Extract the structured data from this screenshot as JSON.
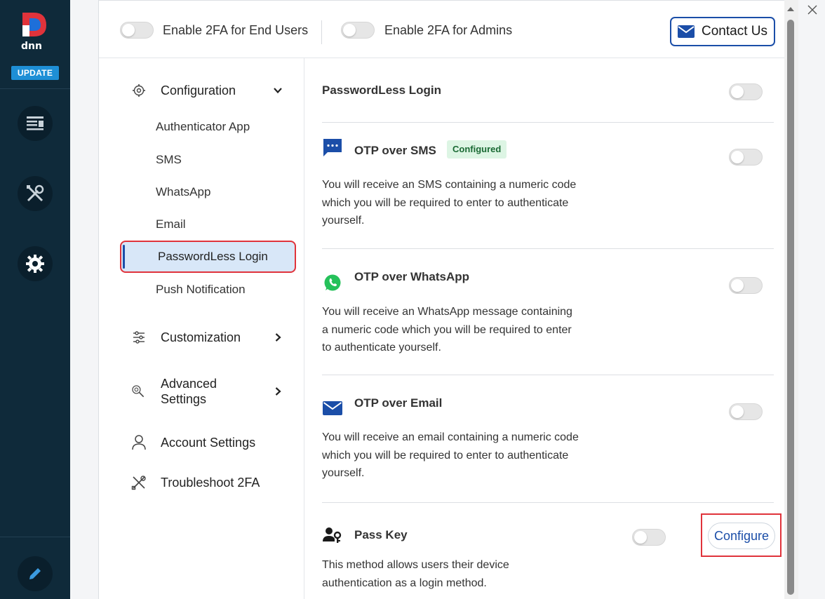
{
  "rail": {
    "update_label": "UPDATE",
    "colors": {
      "bg": "#0f2a3a",
      "update": "#1e8fd6"
    },
    "icons": [
      "dnn-logo-icon",
      "content-icon",
      "tools-icon",
      "settings-gear-icon",
      "edit-pencil-icon"
    ]
  },
  "topbar": {
    "toggle_end_users_label": "Enable 2FA for End Users",
    "toggle_admins_label": "Enable 2FA for Admins",
    "contact_label": "Contact Us"
  },
  "nav": {
    "configuration": {
      "label": "Configuration",
      "items": [
        "Authenticator App",
        "SMS",
        "WhatsApp",
        "Email",
        "PasswordLess Login",
        "Push Notification"
      ],
      "active": "PasswordLess Login"
    },
    "customization": "Customization",
    "advanced_line1": "Advanced",
    "advanced_line2": "Settings",
    "account_settings": "Account Settings",
    "troubleshoot": "Troubleshoot 2FA"
  },
  "content": {
    "passwordless": {
      "title": "PasswordLess Login"
    },
    "sms": {
      "title": "OTP over SMS",
      "badge": "Configured",
      "desc_1": "You will receive an SMS containing a numeric code",
      "desc_2": "which you will be required to enter to authenticate",
      "desc_3": "yourself."
    },
    "whatsapp": {
      "title": "OTP over WhatsApp",
      "desc_1": "You will receive an WhatsApp message containing",
      "desc_2": "a numeric code which you will be required to enter",
      "desc_3": "to authenticate yourself."
    },
    "email": {
      "title": "OTP over Email",
      "desc_1": "You will receive an email containing a numeric code",
      "desc_2": "which you will be required to enter to authenticate",
      "desc_3": "yourself."
    },
    "passkey": {
      "title": "Pass Key",
      "configure_label": "Configure",
      "desc_1": "This method allows users their device",
      "desc_2": "authentication as a login method."
    }
  }
}
